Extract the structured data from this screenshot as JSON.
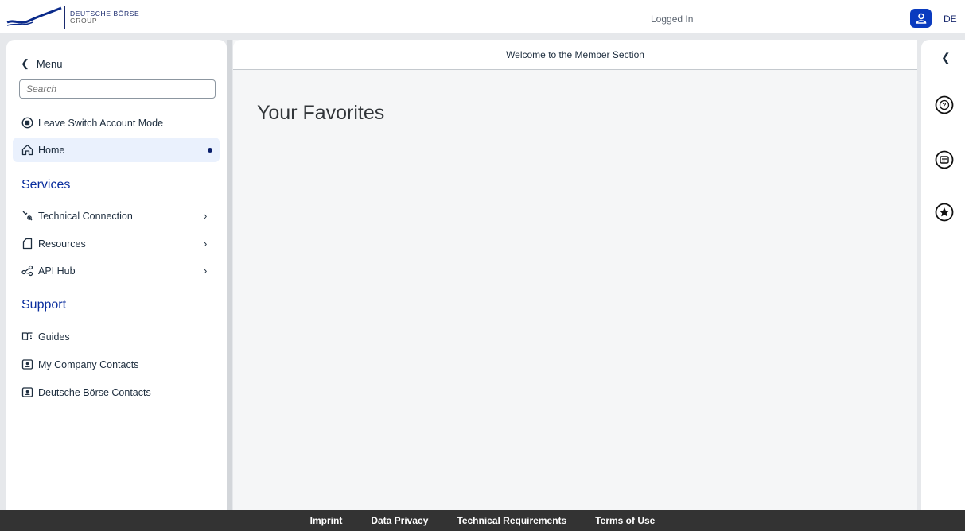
{
  "header": {
    "brand_line1": "DEUTSCHE BÖRSE",
    "brand_line2": "GROUP",
    "status": "Logged In",
    "language": "DE"
  },
  "sidebar": {
    "menu_label": "Menu",
    "search_placeholder": "Search",
    "leave_switch": "Leave Switch Account Mode",
    "home": "Home",
    "services_title": "Services",
    "services": [
      {
        "label": "Technical Connection",
        "icon": "technical-connection-icon"
      },
      {
        "label": "Resources",
        "icon": "document-icon"
      },
      {
        "label": "API Hub",
        "icon": "share-network-icon"
      }
    ],
    "support_title": "Support",
    "support": [
      {
        "label": "Guides",
        "icon": "guide-book-icon"
      },
      {
        "label": "My Company Contacts",
        "icon": "contact-card-icon"
      },
      {
        "label": "Deutsche Börse Contacts",
        "icon": "contact-card-icon"
      }
    ]
  },
  "main": {
    "header_title": "Welcome to the Member Section",
    "page_title": "Your Favorites"
  },
  "rail": {
    "items": [
      "help-icon",
      "feedback-icon",
      "favorites-star-icon"
    ]
  },
  "footer": {
    "links": [
      "Imprint",
      "Data Privacy",
      "Technical Requirements",
      "Terms of Use"
    ]
  },
  "colors": {
    "brand_blue": "#0a3bbf",
    "section_blue": "#0a2e9e",
    "footer_bg": "#333333"
  }
}
